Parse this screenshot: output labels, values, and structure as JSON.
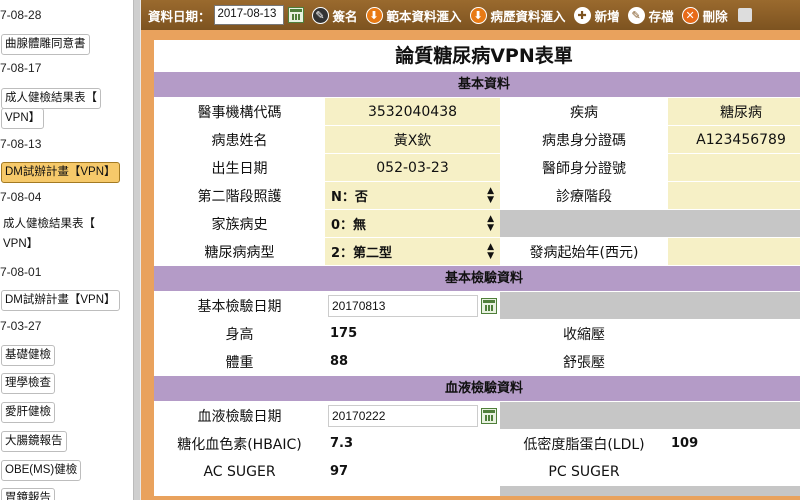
{
  "sidebar": {
    "entries": [
      {
        "type": "date",
        "text": "7-08-28"
      },
      {
        "type": "button",
        "text": "曲腺體雕同意書"
      },
      {
        "type": "date",
        "text": "7-08-17"
      },
      {
        "type": "button",
        "text": "成人健檢結果表【"
      },
      {
        "type": "button",
        "text": "VPN】"
      },
      {
        "type": "date",
        "text": "7-08-13"
      },
      {
        "type": "button",
        "text": "DM試辦計畫【VPN】",
        "active": true
      },
      {
        "type": "date",
        "text": "7-08-04"
      },
      {
        "type": "plain",
        "text": "成人健檢結果表【"
      },
      {
        "type": "plain",
        "text": "VPN】"
      },
      {
        "type": "date",
        "text": "7-08-01"
      },
      {
        "type": "button",
        "text": "DM試辦計畫【VPN】"
      },
      {
        "type": "date",
        "text": "7-03-27"
      },
      {
        "type": "button",
        "text": "基礎健檢"
      },
      {
        "type": "button",
        "text": "理學檢查"
      },
      {
        "type": "button",
        "text": "愛肝健檢"
      },
      {
        "type": "button",
        "text": "大腸鏡報告"
      },
      {
        "type": "button",
        "text": "OBE(MS)健檢"
      },
      {
        "type": "button",
        "text": "胃鏡報告"
      }
    ]
  },
  "toolbar": {
    "date_label": "資料日期：",
    "date_value": "2017-08-13",
    "sign": "簽名",
    "sample_import": "範本資料滙入",
    "history_import": "病歷資料滙入",
    "add": "新增",
    "save": "存檔",
    "delete": "刪除"
  },
  "form": {
    "title": "論質糖尿病VPN表單",
    "sections": {
      "basic": "基本資料",
      "basic_exam": "基本檢驗資料",
      "blood": "血液檢驗資料"
    },
    "basic": {
      "org_code_label": "醫事機構代碼",
      "org_code": "3532040438",
      "disease_label": "疾病",
      "disease": "糖尿病",
      "patient_name_label": "病患姓名",
      "patient_name": "黃X欽",
      "patient_id_label": "病患身分證碼",
      "patient_id": "A123456789",
      "birth_label": "出生日期",
      "birth": "052-03-23",
      "doctor_id_label": "醫師身分證號",
      "doctor_id": "",
      "phase2_label": "第二階段照護",
      "phase2": "N：否",
      "stage_label": "診療階段",
      "stage": "",
      "family_label": "家族病史",
      "family": "0：無",
      "dm_type_label": "糖尿病病型",
      "dm_type": "2：第二型",
      "onset_label": "發病起始年(西元)",
      "onset": ""
    },
    "basic_exam": {
      "date_label": "基本檢驗日期",
      "date": "20170813",
      "height_label": "身高",
      "height": "175",
      "systolic_label": "收縮壓",
      "weight_label": "體重",
      "weight": "88",
      "diastolic_label": "舒張壓"
    },
    "blood": {
      "date_label": "血液檢驗日期",
      "date": "20170222",
      "hba1c_label": "糖化血色素(HBAIC)",
      "hba1c": "7.3",
      "ldl_label": "低密度脂蛋白(LDL)",
      "ldl": "109",
      "ac_label": "AC SUGER",
      "ac": "97",
      "pc_label": "PC SUGER"
    }
  }
}
